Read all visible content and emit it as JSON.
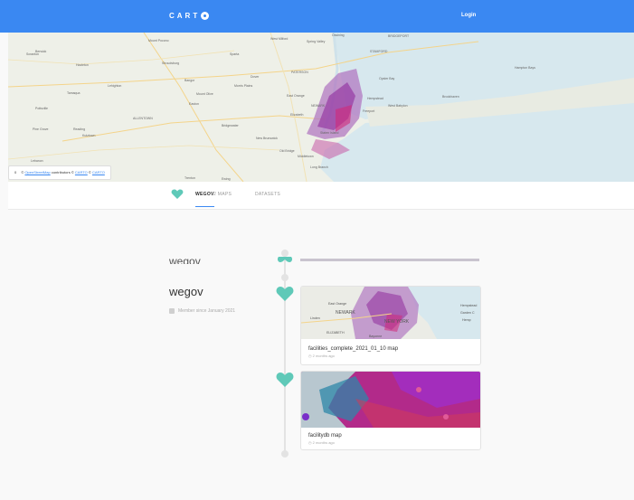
{
  "header": {
    "logo": "CART",
    "login_label": "Login"
  },
  "map_banner": {
    "attribution_number": "0",
    "attribution_link1": "OpenStreetMap",
    "attribution_text": "contributors ©",
    "attribution_link2": "CARTO",
    "attribution_sep": "©",
    "attribution_link3": "CARTO",
    "labels": [
      "Scranton",
      "Stroudsburg",
      "Mount Pocono",
      "Sparta",
      "West Milford",
      "Spring Valley",
      "Ossining",
      "BRIDGEPORT",
      "Berwick",
      "Hazleton",
      "Lehighton",
      "Bangor",
      "Dover",
      "Morris Plains",
      "PATERSON",
      "STAMFORD",
      "Oyster Bay",
      "Hampton Bays",
      "Tamaqua",
      "Easton",
      "Mount Olive",
      "East Orange",
      "NEWARK",
      "Elizabeth",
      "Hempstead",
      "West Babylon",
      "Brookhaven",
      "Pottsville",
      "ALLENTOWN",
      "Bridgewater",
      "New Brunswick",
      "Staten Island",
      "Freeport",
      "Pine Grove",
      "Reading",
      "Kutztown",
      "Old Bridge",
      "Middletown",
      "Long Branch",
      "Lebanon",
      "Lancaster",
      "Trenton",
      "Ewing"
    ]
  },
  "tabs": {
    "profile": "WEGOV",
    "maps": "2 MAPS",
    "datasets": "DATASETS"
  },
  "profile": {
    "ghost_name": "wegov",
    "name": "wegov",
    "member_since": "Member since January 2021"
  },
  "maps": [
    {
      "title": "facilities_complete_2021_01_10 map",
      "updated": "2 months ago",
      "labels": [
        "East Orange",
        "NEWARK",
        "Linden",
        "NEW YORK",
        "ELIZABETH",
        "Bayonne",
        "Hempstead",
        "Garden C",
        "Hemp"
      ]
    },
    {
      "title": "facilitydb map",
      "updated": "2 months ago"
    }
  ],
  "colors": {
    "brand_blue": "#3a88f2",
    "teal_heart": "#5fc9b8",
    "point_purple": "#8f2b9c",
    "point_pink": "#d12a7a"
  }
}
